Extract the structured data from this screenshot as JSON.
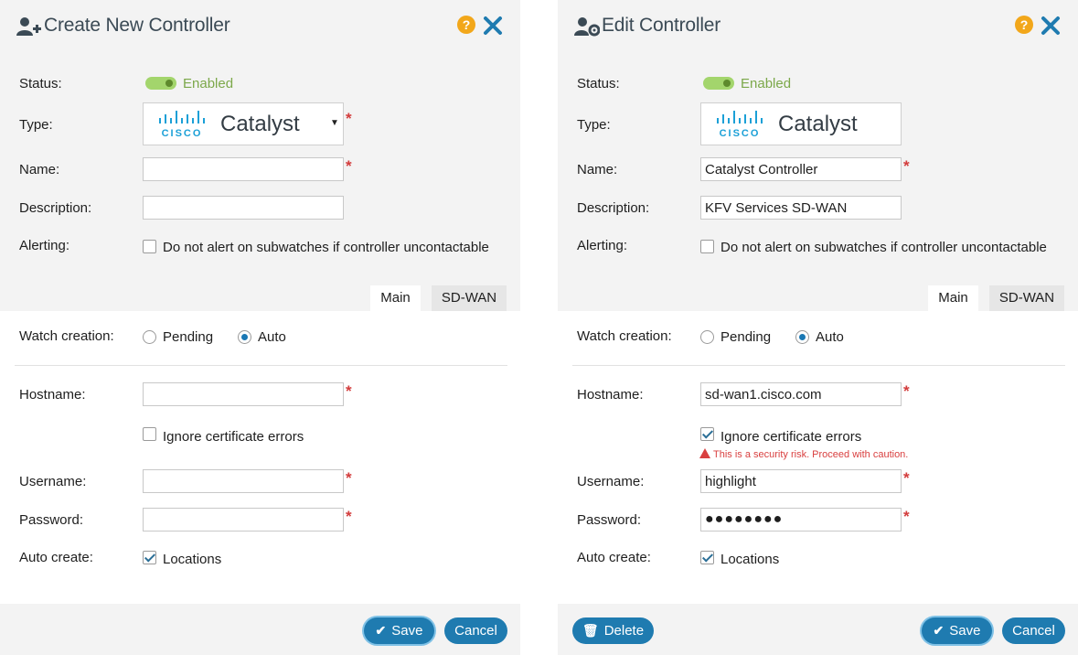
{
  "create": {
    "title": "Create New Controller",
    "labels": {
      "status": "Status:",
      "type": "Type:",
      "name": "Name:",
      "description": "Description:",
      "alerting": "Alerting:",
      "watch_creation": "Watch creation:",
      "hostname": "Hostname:",
      "username": "Username:",
      "password": "Password:",
      "auto_create": "Auto create:"
    },
    "status_text": "Enabled",
    "type_brand": "Catalyst",
    "type_logo": "cisco-logo",
    "alert_checkbox_label": "Do not alert on subwatches if controller uncontactable",
    "alert_checked": false,
    "tabs": [
      "Main",
      "SD-WAN"
    ],
    "watch_options": [
      "Pending",
      "Auto"
    ],
    "watch_selected": "Auto",
    "ignore_cert_label": "Ignore certificate errors",
    "ignore_cert_checked": false,
    "auto_create_label": "Locations",
    "auto_create_checked": true,
    "fields": {
      "name": "",
      "description": "",
      "hostname": "",
      "username": "",
      "password": ""
    },
    "buttons": {
      "save": "Save",
      "cancel": "Cancel"
    }
  },
  "edit": {
    "title": "Edit Controller",
    "labels": {
      "status": "Status:",
      "type": "Type:",
      "name": "Name:",
      "description": "Description:",
      "alerting": "Alerting:",
      "watch_creation": "Watch creation:",
      "hostname": "Hostname:",
      "username": "Username:",
      "password": "Password:",
      "auto_create": "Auto create:"
    },
    "status_text": "Enabled",
    "type_brand": "Catalyst",
    "type_logo": "cisco-logo",
    "alert_checkbox_label": "Do not alert on subwatches if controller uncontactable",
    "alert_checked": false,
    "tabs": [
      "Main",
      "SD-WAN"
    ],
    "watch_options": [
      "Pending",
      "Auto"
    ],
    "watch_selected": "Auto",
    "ignore_cert_label": "Ignore certificate errors",
    "ignore_cert_checked": true,
    "security_warning": "This is a security risk. Proceed with caution.",
    "auto_create_label": "Locations",
    "auto_create_checked": true,
    "fields": {
      "name": "Catalyst Controller",
      "description": "KFV Services SD-WAN",
      "hostname": "sd-wan1.cisco.com",
      "username": "highlight",
      "password": "●●●●●●●●"
    },
    "buttons": {
      "delete": "Delete",
      "save": "Save",
      "cancel": "Cancel"
    }
  },
  "required_mark": "*",
  "icons": {
    "create_title": "user-add-icon",
    "edit_title": "user-settings-icon",
    "help": "help-icon",
    "close": "close-icon",
    "save": "check-icon",
    "delete": "trash-icon",
    "warning": "warning-icon"
  },
  "colors": {
    "accent": "#1f7bb0",
    "enabled_green": "#a3d56c",
    "help_orange": "#f2a71a",
    "required_red": "#d33c3c"
  }
}
